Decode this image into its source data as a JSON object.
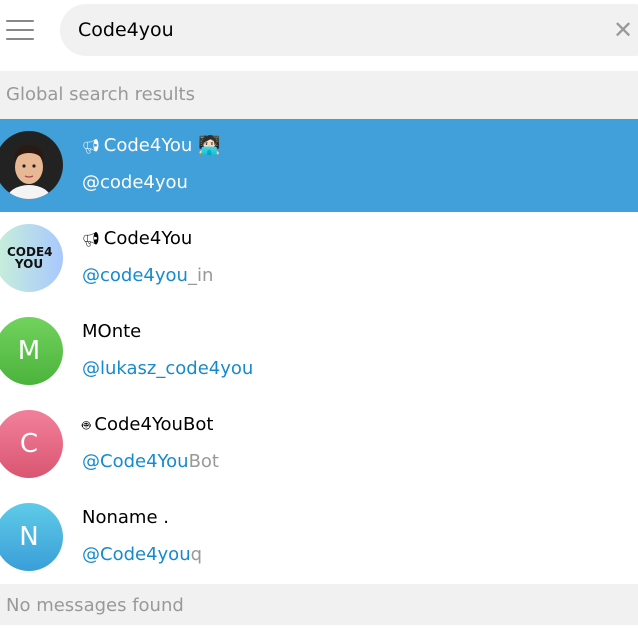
{
  "search": {
    "value": "Code4you",
    "clear_icon": "close-icon"
  },
  "sections": {
    "global": "Global search results",
    "messages": "No messages found"
  },
  "results": [
    {
      "name": "Code4You",
      "type_icon": "megaphone-icon",
      "emoji": "🧑🏻‍💻",
      "username_match": "@code4you",
      "username_rest": "",
      "selected": true,
      "avatar": "photo",
      "avatar_color": "#222222"
    },
    {
      "name": "Code4You",
      "type_icon": "megaphone-icon",
      "username_match": "@code4you",
      "username_rest": "_in",
      "avatar": "logo",
      "avatar_logo": "CODE4 YOU",
      "avatar_color": "#b8e6d6"
    },
    {
      "name": "MOnte",
      "username_match": "@lukasz_code4you",
      "username_rest": "",
      "avatar_letter": "M",
      "avatar_color": "#5cc44a"
    },
    {
      "name": "Code4YouBot",
      "type_icon": "bot-icon",
      "username_match": "@Code4You",
      "username_rest": "Bot",
      "avatar_letter": "C",
      "avatar_color": "#e4687f"
    },
    {
      "name": "Noname .",
      "username_match": "@Code4you",
      "username_rest": "q",
      "avatar_letter": "N",
      "avatar_color": "#4ab2de"
    }
  ],
  "colors": {
    "accent": "#419fd9",
    "link": "#168acd"
  }
}
